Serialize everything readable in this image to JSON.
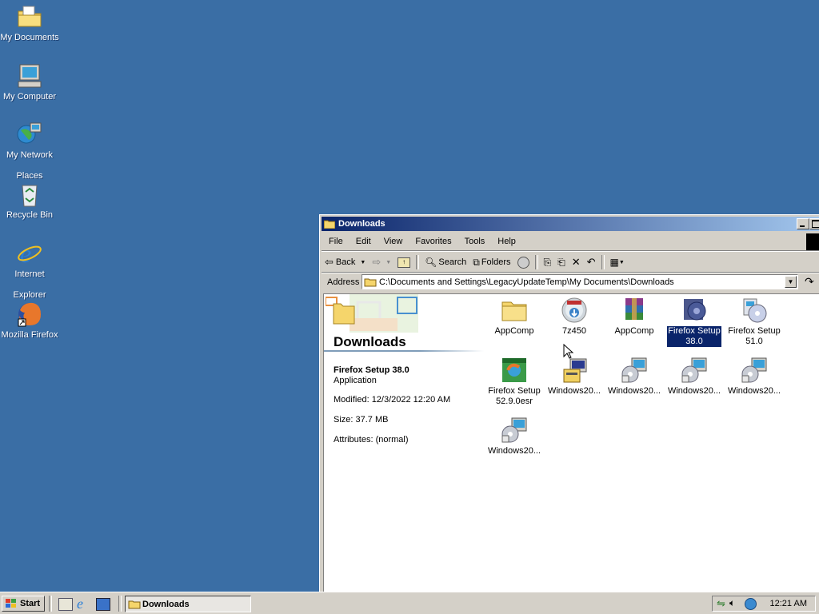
{
  "desktop": {
    "icons": [
      {
        "label_line1": "My Documents",
        "label_line2": "",
        "icon": "my-documents-icon"
      },
      {
        "label_line1": "My Computer",
        "label_line2": "",
        "icon": "my-computer-icon"
      },
      {
        "label_line1": "My Network",
        "label_line2": "Places",
        "icon": "network-places-icon"
      },
      {
        "label_line1": "Recycle Bin",
        "label_line2": "",
        "icon": "recycle-bin-icon"
      },
      {
        "label_line1": "Internet",
        "label_line2": "Explorer",
        "icon": "internet-explorer-icon"
      },
      {
        "label_line1": "Mozilla Firefox",
        "label_line2": "",
        "icon": "firefox-icon"
      }
    ]
  },
  "window": {
    "title": "Downloads",
    "menu": [
      "File",
      "Edit",
      "View",
      "Favorites",
      "Tools",
      "Help"
    ],
    "toolbar": {
      "back": "Back",
      "search": "Search",
      "folders": "Folders"
    },
    "address": {
      "label": "Address",
      "value": "C:\\Documents and Settings\\LegacyUpdateTemp\\My Documents\\Downloads"
    },
    "left_pane": {
      "folder_title": "Downloads",
      "selected_name": "Firefox Setup 38.0",
      "selected_type": "Application",
      "modified": "Modified: 12/3/2022 12:20 AM",
      "size": "Size: 37.7 MB",
      "attributes": "Attributes: (normal)"
    },
    "items": [
      {
        "line1": "AppComp",
        "line2": "",
        "icon": "folder-icon",
        "selected": false
      },
      {
        "line1": "7z450",
        "line2": "",
        "icon": "installer-disc-icon",
        "selected": false
      },
      {
        "line1": "AppComp",
        "line2": "",
        "icon": "winrar-archive-icon",
        "selected": false
      },
      {
        "line1": "Firefox Setup",
        "line2": "38.0",
        "icon": "firefox-setup-icon",
        "selected": true
      },
      {
        "line1": "Firefox Setup",
        "line2": "51.0",
        "icon": "setup-cd-icon",
        "selected": false
      },
      {
        "line1": "Firefox Setup",
        "line2": "52.9.0esr",
        "icon": "firefox-installer-icon",
        "selected": false
      },
      {
        "line1": "Windows20...",
        "line2": "",
        "icon": "setup-program-icon",
        "selected": false
      },
      {
        "line1": "Windows20...",
        "line2": "",
        "icon": "windows-update-icon",
        "selected": false
      },
      {
        "line1": "Windows20...",
        "line2": "",
        "icon": "windows-update-icon",
        "selected": false
      },
      {
        "line1": "Windows20...",
        "line2": "",
        "icon": "windows-update-icon",
        "selected": false
      },
      {
        "line1": "Windows20...",
        "line2": "",
        "icon": "windows-update-icon",
        "selected": false
      }
    ]
  },
  "taskbar": {
    "start_label": "Start",
    "task_label": "Downloads",
    "clock": "12:21 AM"
  }
}
